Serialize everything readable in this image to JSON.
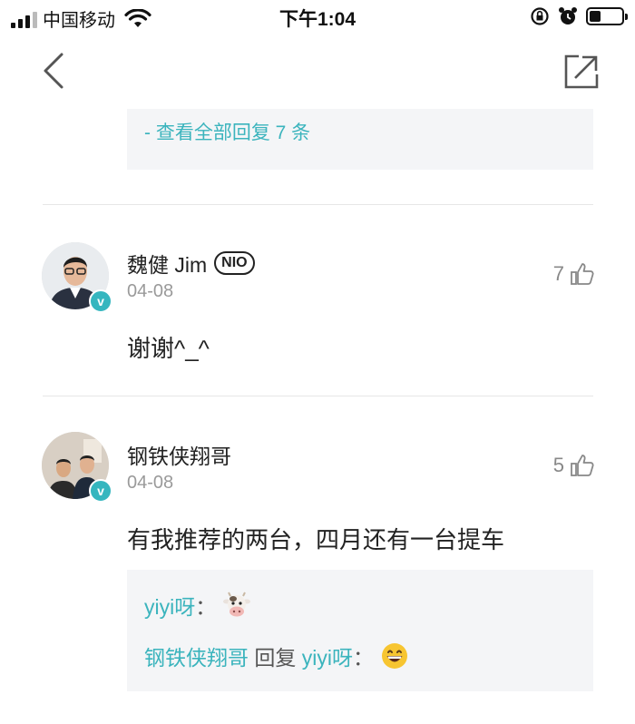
{
  "status_bar": {
    "carrier": "中国移动",
    "time": "下午1:04",
    "battery_level": 0.35
  },
  "nav": {
    "back_icon": "chevron-left-icon",
    "share_icon": "share-icon"
  },
  "replies_summary": {
    "link_text": "- 查看全部回复 7 条"
  },
  "comments": [
    {
      "name": "魏健 Jim",
      "badge": "NIO",
      "verified_icon": "v",
      "date": "04-08",
      "likes": "7",
      "text": "谢谢^_^"
    },
    {
      "name": "钢铁侠翔哥",
      "verified_icon": "v",
      "date": "04-08",
      "likes": "5",
      "text": "有我推荐的两台，四月还有一台提车",
      "replies": [
        {
          "user": "yiyi呀",
          "separator": "：",
          "emoji": "cow-face-emoji"
        },
        {
          "user": "钢铁侠翔哥",
          "action": " 回复 ",
          "target": "yiyi呀",
          "separator": "：",
          "emoji": "grinning-face-emoji"
        }
      ]
    }
  ],
  "colors": {
    "accent": "#3bb4bd",
    "reply_bg": "#f4f5f7",
    "muted": "#9a9a9a"
  }
}
